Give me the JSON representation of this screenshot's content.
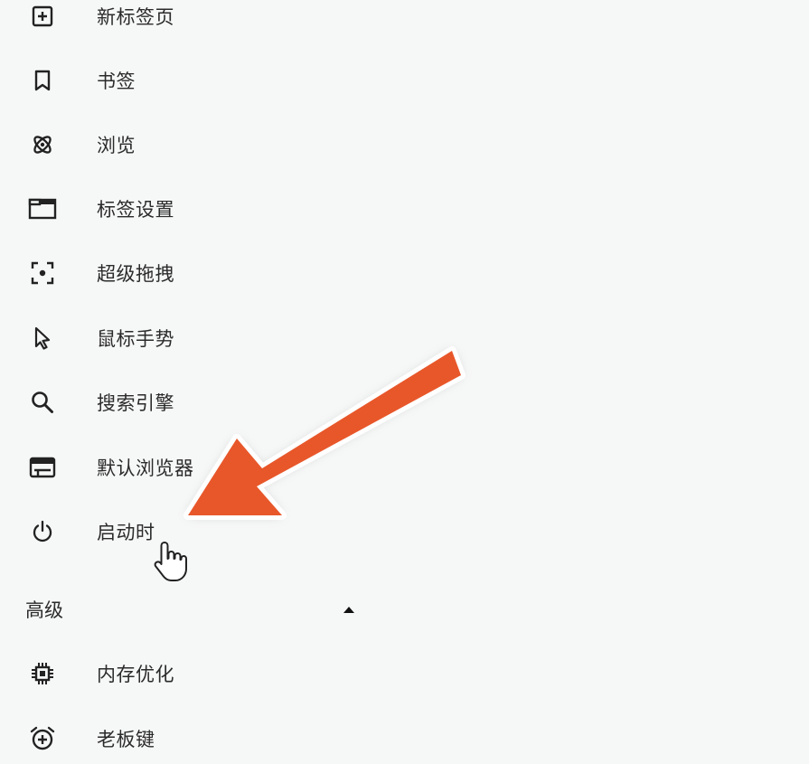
{
  "menu": {
    "items": [
      {
        "label": "新标签页",
        "icon": "new-tab-icon"
      },
      {
        "label": "书签",
        "icon": "bookmark-icon"
      },
      {
        "label": "浏览",
        "icon": "browse-icon"
      },
      {
        "label": "标签设置",
        "icon": "tab-settings-icon"
      },
      {
        "label": "超级拖拽",
        "icon": "super-drag-icon"
      },
      {
        "label": "鼠标手势",
        "icon": "mouse-gesture-icon"
      },
      {
        "label": "搜索引擎",
        "icon": "search-icon"
      },
      {
        "label": "默认浏览器",
        "icon": "default-browser-icon"
      },
      {
        "label": "启动时",
        "icon": "power-icon"
      }
    ],
    "advanced": {
      "title": "高级",
      "toggle_icon": "caret-up-icon",
      "items": [
        {
          "label": "内存优化",
          "icon": "chip-icon"
        },
        {
          "label": "老板键",
          "icon": "alarm-clock-icon"
        }
      ]
    }
  },
  "annotation": {
    "arrow_color": "#e8572a"
  }
}
